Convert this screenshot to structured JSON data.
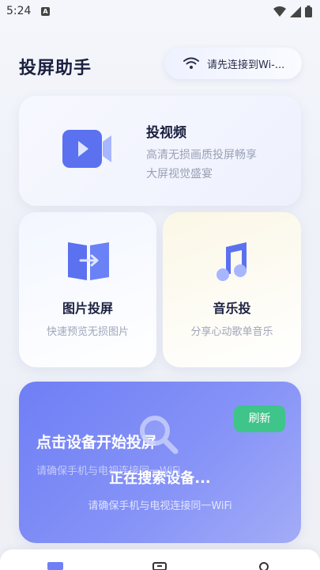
{
  "status": {
    "time": "5:24",
    "notif": "A"
  },
  "header": {
    "title": "投屏助手",
    "wifi_label": "请先连接到Wi-..."
  },
  "video_card": {
    "title": "投视频",
    "desc_line1": "高清无损画质投屏畅享",
    "desc_line2": "大屏视觉盛宴"
  },
  "photo_card": {
    "title": "图片投屏",
    "desc": "快速预览无损图片"
  },
  "music_card": {
    "title": "音乐投",
    "desc": "分享心动歌单音乐"
  },
  "connect_card": {
    "title": "点击设备开始投屏",
    "desc": "请确保手机与电视连接同一WiFi",
    "refresh_label": "刷新",
    "searching_label": "正在搜索设备...",
    "searching_hint": "请确保手机与电视连接同一WiFi"
  },
  "colors": {
    "accent": "#6f7ff5",
    "refresh": "#3fc48a"
  }
}
